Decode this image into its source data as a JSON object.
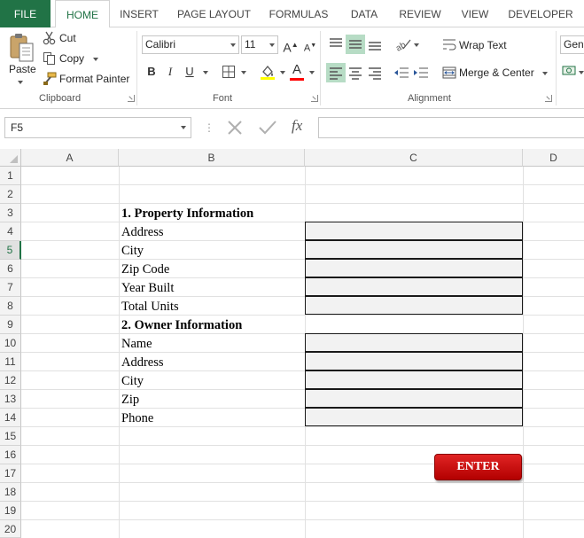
{
  "ribbon_tabs": [
    {
      "label": "FILE"
    },
    {
      "label": "HOME"
    },
    {
      "label": "INSERT"
    },
    {
      "label": "PAGE LAYOUT"
    },
    {
      "label": "FORMULAS"
    },
    {
      "label": "DATA"
    },
    {
      "label": "REVIEW"
    },
    {
      "label": "VIEW"
    },
    {
      "label": "DEVELOPER"
    }
  ],
  "clipboard": {
    "paste_label": "Paste",
    "cut_label": "Cut",
    "copy_label": "Copy",
    "format_painter_label": "Format Painter",
    "group_label": "Clipboard"
  },
  "font": {
    "font_name": "Calibri",
    "font_size": "11",
    "bold_label": "B",
    "italic_label": "I",
    "underline_label": "U",
    "grow_label": "A",
    "shrink_label": "A",
    "font_color_label": "A",
    "group_label": "Font"
  },
  "alignment": {
    "wrap_text_label": "Wrap Text",
    "merge_center_label": "Merge & Center",
    "group_label": "Alignment"
  },
  "number": {
    "format_value": "Gene"
  },
  "formula_bar": {
    "name_box": "F5",
    "fx_label": "fx",
    "formula": ""
  },
  "columns": [
    "A",
    "B",
    "C",
    "D"
  ],
  "rows": [
    "1",
    "2",
    "3",
    "4",
    "5",
    "6",
    "7",
    "8",
    "9",
    "10",
    "11",
    "12",
    "13",
    "14",
    "15",
    "16",
    "17",
    "18",
    "19",
    "20"
  ],
  "selected_row": "5",
  "sheet": {
    "section1_title": "1. Property Information",
    "section1_fields": [
      "Address",
      "City",
      "Zip Code",
      "Year Built",
      "Total Units"
    ],
    "section2_title": "2. Owner  Information",
    "section2_fields": [
      "Name",
      "Address",
      "City",
      "Zip",
      "Phone"
    ],
    "enter_button": "ENTER"
  },
  "colors": {
    "excel_green": "#217346",
    "enter_red": "#cc0000",
    "input_fill": "#f2f2f2"
  }
}
